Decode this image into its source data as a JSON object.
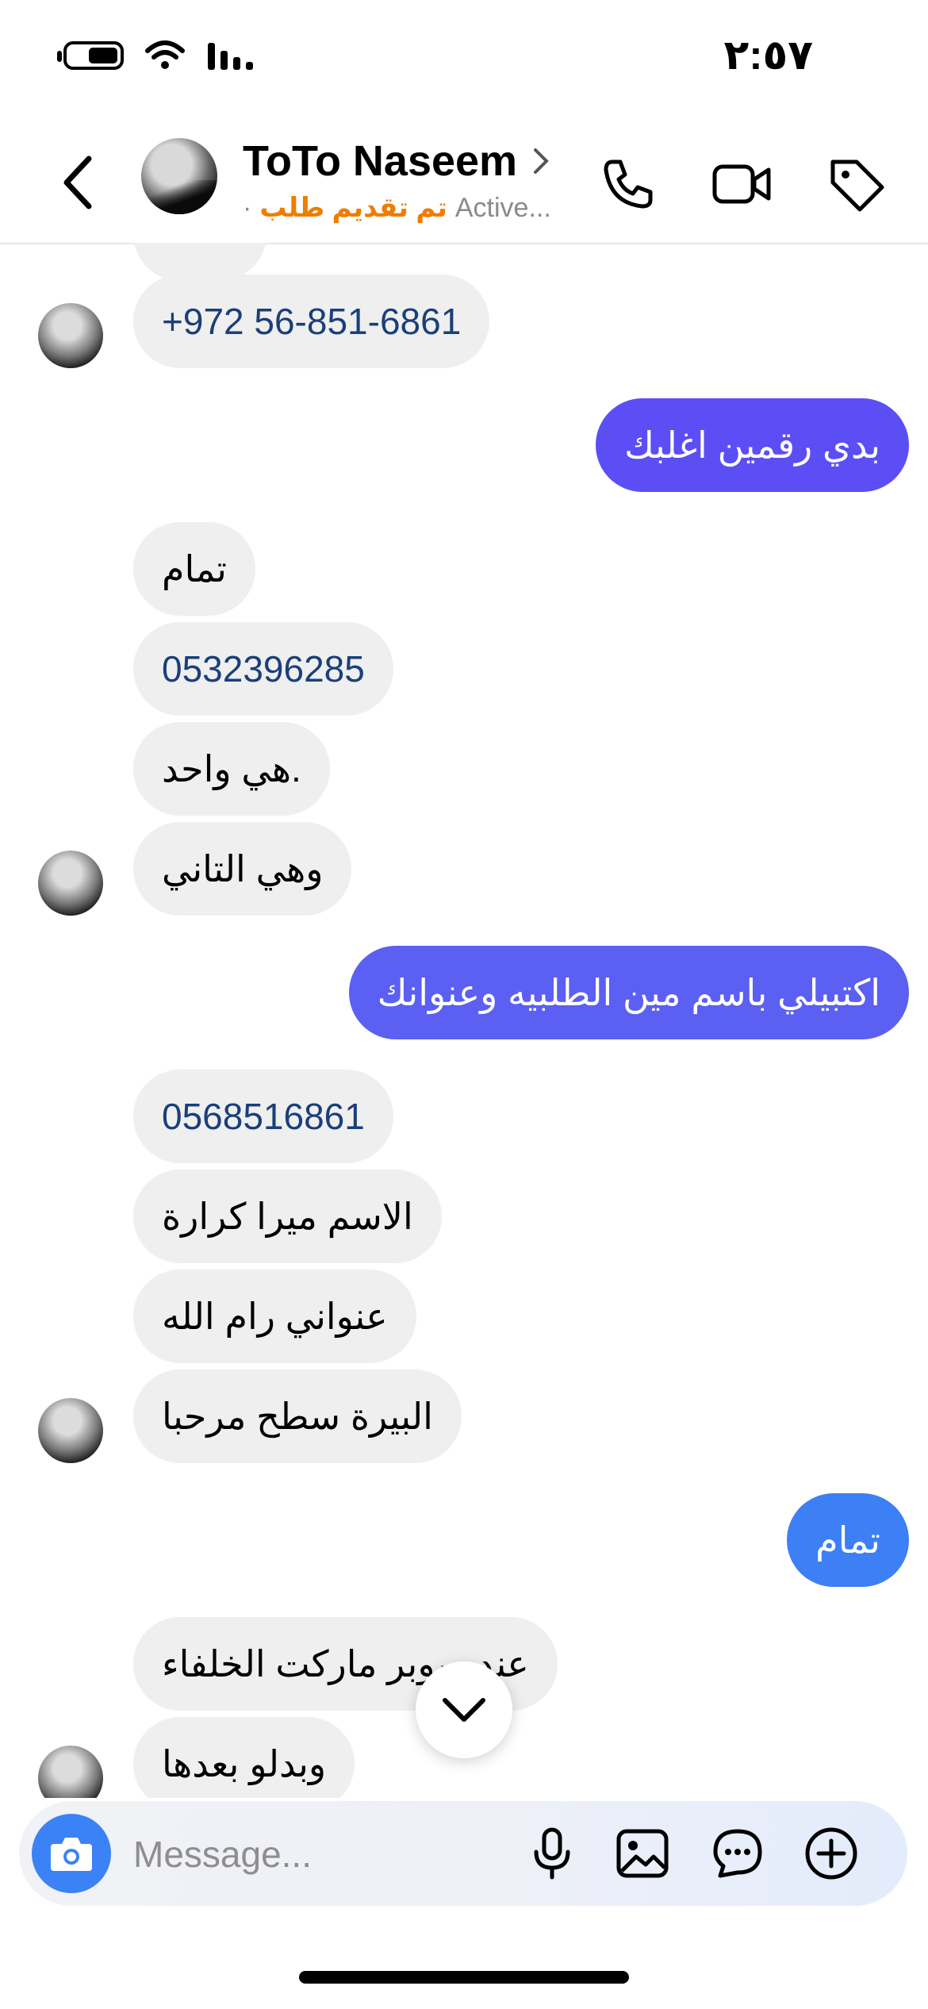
{
  "status_bar": {
    "time": "٢:٥٧"
  },
  "header": {
    "contact_name": "ToTo Naseem",
    "order_status": "تم تقديم طلب",
    "separator": "·",
    "active_text": "Active..."
  },
  "messages": [
    {
      "type": "incoming",
      "text": "+972 56-851-6861",
      "phone": true
    },
    {
      "type": "outgoing",
      "text": "بدي رقمين اغلبك",
      "color": "#5b4ef5"
    },
    {
      "type": "incoming",
      "text": "تمام"
    },
    {
      "type": "incoming",
      "text": "0532396285",
      "phone": true
    },
    {
      "type": "incoming",
      "text": "هي واحد."
    },
    {
      "type": "incoming",
      "text": "وهي التاني"
    },
    {
      "type": "outgoing",
      "text": "اكتبيلي باسم مين الطلبيه وعنوانك",
      "color": "#5b5ff2"
    },
    {
      "type": "incoming",
      "text": "0568516861",
      "phone": true
    },
    {
      "type": "incoming",
      "text": "الاسم ميرا كرارة"
    },
    {
      "type": "incoming",
      "text": "عنواني رام الله"
    },
    {
      "type": "incoming",
      "text": "البيرة سطح مرحبا"
    },
    {
      "type": "outgoing",
      "text": "تمام",
      "color": "#3d7ff5"
    },
    {
      "type": "incoming",
      "text": "عند سوبر ماركت الخلفاء"
    },
    {
      "type": "incoming",
      "text": "وبدلو بعدها"
    }
  ],
  "composer": {
    "placeholder": "Message..."
  },
  "icons": {
    "back": "chevron-left-icon",
    "call": "phone-icon",
    "video": "video-camera-icon",
    "tag": "tag-icon",
    "camera": "camera-icon",
    "mic": "microphone-icon",
    "gallery": "image-icon",
    "sticker": "chat-bubble-icon",
    "more": "plus-circle-icon",
    "scroll": "chevron-down-icon"
  }
}
